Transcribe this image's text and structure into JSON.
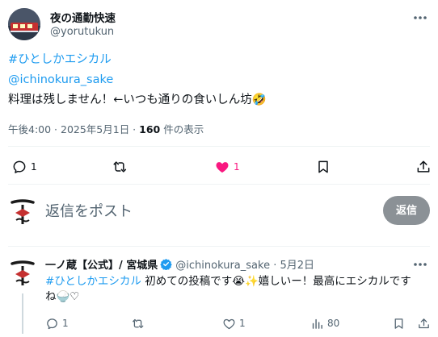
{
  "tweet": {
    "author": {
      "display_name": "夜の通勤快速",
      "handle": "@yorutukun"
    },
    "hashtag": "#ひとしかエシカル",
    "mention": "@ichinokura_sake",
    "text": "料理は残しません！←いつも通りの食いしん坊🤣",
    "time": "午後4:00 · 2025年5月1日 · ",
    "view_count": "160",
    "view_label": " 件の表示",
    "stats": {
      "replies": "1",
      "likes": "1"
    }
  },
  "compose": {
    "placeholder": "返信をポスト",
    "reply_button": "返信"
  },
  "reply": {
    "display_name": "一ノ蔵【公式】/ 宮城県",
    "handle_date": "@ichinokura_sake · 5月2日",
    "hashtag": "#ひとしかエシカル",
    "text_line1": " 初めての投稿です😭✨嬉しいー！最高にエシカルです",
    "text_line2": "ね🍚♡",
    "stats": {
      "replies": "1",
      "likes": "1",
      "views": "80"
    }
  },
  "colors": {
    "link": "#1d9bf0",
    "like_active": "#f91880",
    "muted": "#536471",
    "reply_button_bg": "#8b9196"
  }
}
